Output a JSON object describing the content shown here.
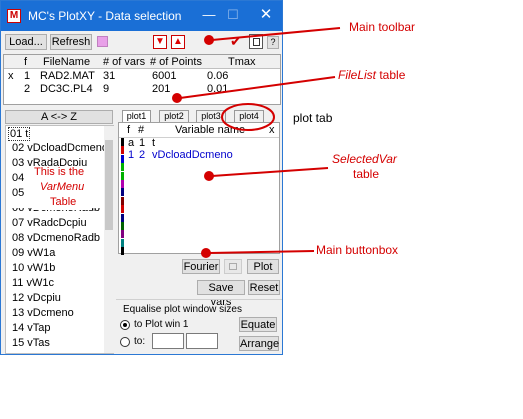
{
  "window": {
    "title": "MC's PlotXY - Data selection",
    "app_icon": "plotxy-app-icon"
  },
  "toolbar": {
    "load": "Load...",
    "refresh": "Refresh",
    "help": "?"
  },
  "filelist": {
    "headers": [
      "f",
      "FileName",
      "# of vars",
      "# of Points",
      "Tmax"
    ],
    "rows": [
      [
        "x",
        "1",
        "RAD2.MAT",
        "31",
        "6001",
        "0.06"
      ],
      [
        "",
        "2",
        "DC3C.PL4",
        "9",
        "201",
        "0.01"
      ]
    ]
  },
  "varmenu": {
    "sort_button": "A <-> Z",
    "items": [
      "01 t",
      "02 vDcloadDcmeno",
      "03 vRadaDcpiu",
      "04",
      "05",
      "06 vDcmenoRadb",
      "07 vRadcDcpiu",
      "08 vDcmenoRadb",
      "09 vW1a",
      "10 vW1b",
      "11 vW1c",
      "12 vDcpiu",
      "13 vDcmeno",
      "14 vTap",
      "15 vTas"
    ],
    "overlay": [
      "This is the",
      "VarMenu",
      "Table"
    ]
  },
  "plot_tabs": [
    "plot1",
    "plot2",
    "plot3",
    "plot4"
  ],
  "selectedvar": {
    "headers": [
      "f",
      "#",
      "Variable name",
      "x"
    ],
    "rows": [
      [
        "a",
        "1",
        "t"
      ],
      [
        "1",
        "2",
        "vDcloadDcmeno"
      ]
    ],
    "swatch_colors": [
      "#000000",
      "#d00000",
      "#0000d0",
      "#00b000",
      "#00b000",
      "#b000b0",
      "#000080",
      "#800000",
      "#d00000",
      "#000080",
      "#006000",
      "#800080",
      "#008080",
      "#000000"
    ]
  },
  "buttonbox": {
    "fourier": "Fourier",
    "plot": "Plot",
    "save_vars": "Save vars",
    "reset": "Reset"
  },
  "equalise": {
    "label": "Equalise plot window sizes",
    "option1": "to Plot win 1",
    "option2": "to:",
    "equate": "Equate",
    "arrange": "Arrange"
  },
  "annotations": {
    "main_toolbar": "Main toolbar",
    "filelist": "FileList",
    "filelist_suffix": " table",
    "plot_tab": "plot tab",
    "selectedvar": "SelectedVar",
    "selectedvar_suffix": "table",
    "main_buttonbox": "Main buttonbox"
  },
  "colors": {
    "titlebar": "#1a6fd6",
    "annotation": "#d40000",
    "link_text": "#0000cc"
  }
}
